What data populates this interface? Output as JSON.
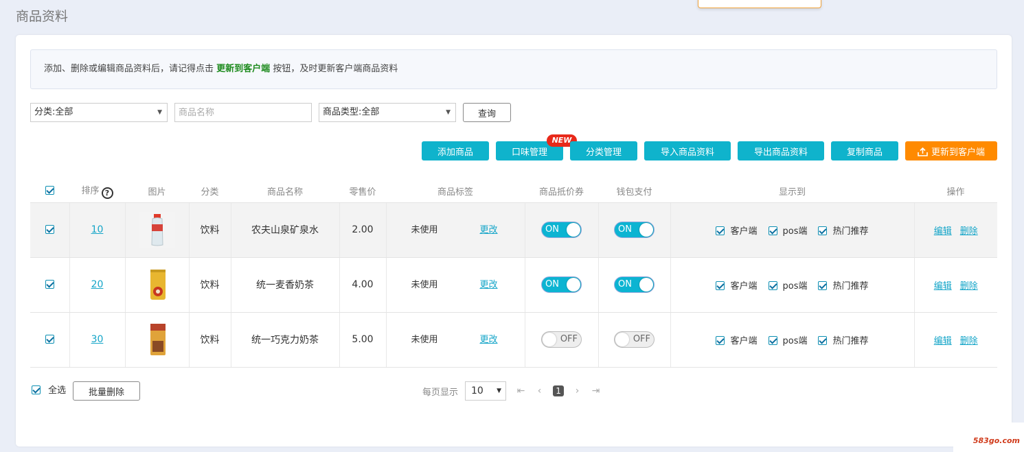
{
  "page": {
    "title": "商品资料"
  },
  "notice": {
    "prefix": "添加、删除或编辑商品资料后，请记得点击",
    "highlight": "更新到客户端",
    "suffix": "按钮，及时更新客户端商品资料"
  },
  "filters": {
    "category": "分类:全部",
    "name_placeholder": "商品名称",
    "type": "商品类型:全部",
    "query_label": "查询"
  },
  "toolbar": {
    "add": "添加商品",
    "flavor": "口味管理",
    "new_badge": "NEW",
    "category_mgmt": "分类管理",
    "import": "导入商品资料",
    "export": "导出商品资料",
    "copy": "复制商品",
    "update_client": "更新到客户端"
  },
  "table": {
    "headers": {
      "sort": "排序",
      "image": "图片",
      "category": "分类",
      "name": "商品名称",
      "price": "零售价",
      "tag": "商品标签",
      "coupon": "商品抵价券",
      "wallet": "钱包支付",
      "show_on": "显示到",
      "ops": "操作"
    },
    "rows": [
      {
        "sort": "10",
        "category": "饮料",
        "name": "农夫山泉矿泉水",
        "price": "2.00",
        "tag": "未使用",
        "tag_edit": "更改",
        "coupon": "ON",
        "wallet": "ON",
        "show": [
          "客户端",
          "pos端",
          "热门推荐"
        ],
        "edit": "编辑",
        "delete": "删除"
      },
      {
        "sort": "20",
        "category": "饮料",
        "name": "统一麦香奶茶",
        "price": "4.00",
        "tag": "未使用",
        "tag_edit": "更改",
        "coupon": "ON",
        "wallet": "ON",
        "show": [
          "客户端",
          "pos端",
          "热门推荐"
        ],
        "edit": "编辑",
        "delete": "删除"
      },
      {
        "sort": "30",
        "category": "饮料",
        "name": "统一巧克力奶茶",
        "price": "5.00",
        "tag": "未使用",
        "tag_edit": "更改",
        "coupon": "OFF",
        "wallet": "OFF",
        "show": [
          "客户端",
          "pos端",
          "热门推荐"
        ],
        "edit": "编辑",
        "delete": "删除"
      }
    ]
  },
  "footer": {
    "select_all": "全选",
    "batch_delete": "批量删除",
    "per_page_label": "每页显示",
    "per_page_value": "10",
    "current_page": "1"
  },
  "watermark": "583go.com",
  "colors": {
    "accent": "#0fb3cc",
    "orange": "#ff8a00",
    "badge": "#e8291a",
    "link": "#14a5c8"
  }
}
